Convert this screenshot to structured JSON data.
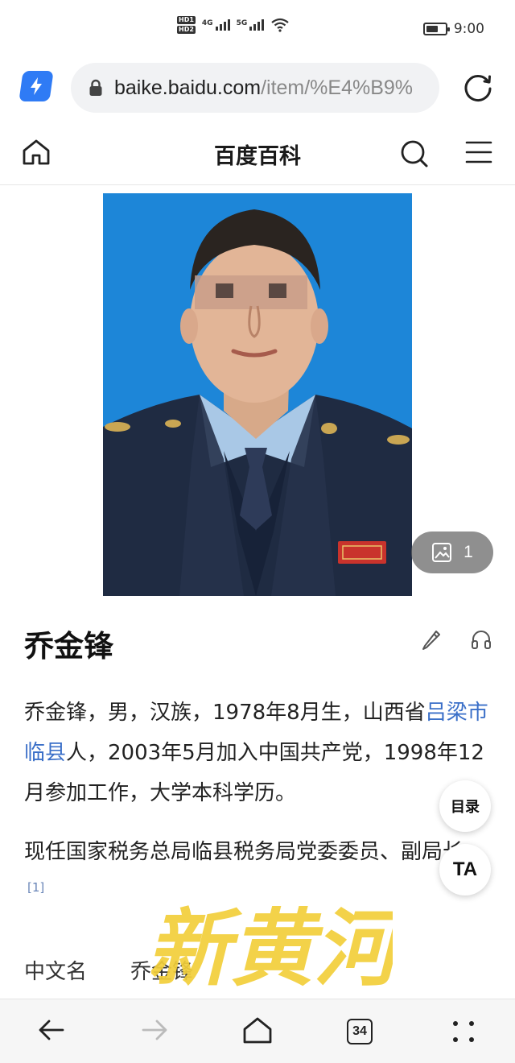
{
  "status_bar": {
    "hd_labels": [
      "HD1",
      "HD2"
    ],
    "network_types": [
      "4G",
      "5G"
    ],
    "time": "9:00",
    "battery_level": 0.65
  },
  "browser": {
    "url_domain": "baike.baidu.com",
    "url_path": "/item/%E4%B9%",
    "icons": [
      "lightning-icon",
      "lock-icon",
      "refresh-icon"
    ]
  },
  "header": {
    "brand": "百度百科",
    "icons": [
      "home-icon",
      "search-icon",
      "menu-icon"
    ]
  },
  "photo": {
    "gallery_count": "1"
  },
  "article": {
    "title": "乔金锋",
    "para1": {
      "before": "乔金锋，男，汉族，1978年8月生，山西省",
      "link": "吕梁市临县",
      "after": "人，2003年5月加入中国共产党，1998年12月参加工作，大学本科学历。"
    },
    "para2": {
      "text": "现任国家税务总局临县税务局党委委员、副局长。",
      "cite": "[1]"
    },
    "infobox": {
      "label": "中文名",
      "value": "乔金锋"
    }
  },
  "floating": {
    "toc": "目录",
    "ta": "TA"
  },
  "watermark": "新黄河",
  "bottom_nav": {
    "tab_count": "34"
  },
  "colors": {
    "photo_bg": "#1d86d8",
    "link": "#3a6fc8",
    "accent": "#2f7bf5",
    "watermark": "#f2cf3a"
  }
}
